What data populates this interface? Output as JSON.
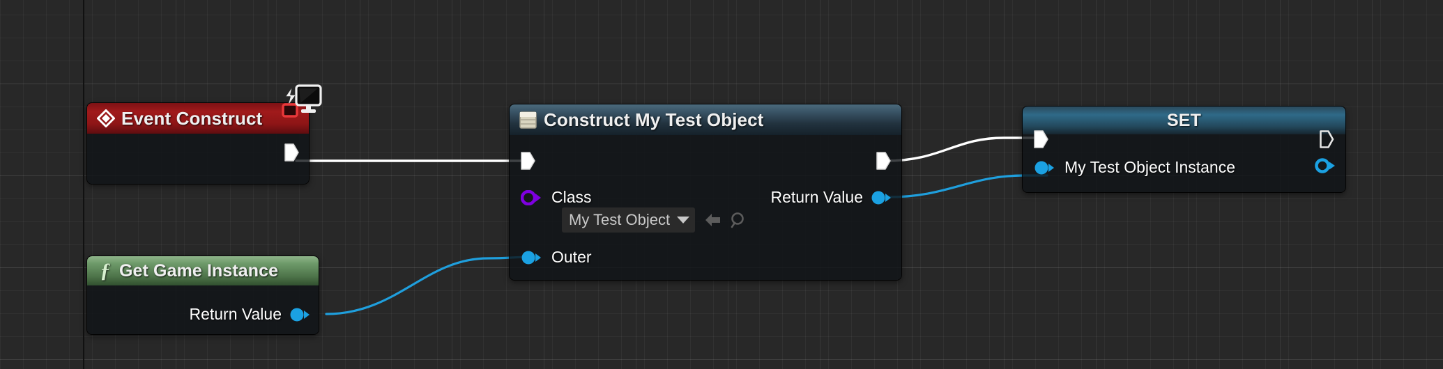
{
  "app": {
    "context": "unreal-blueprint-graph",
    "background_color": "#282828",
    "grid_line_color": "#3a3a3a",
    "axis_line_color": "#111111"
  },
  "colors": {
    "exec_wire": "#ffffff",
    "data_wire_object": "#1f9fdd",
    "pin_object_blue": "#1ba1e2",
    "pin_class_purple": "#7e00e0",
    "title_event_red": "#a01a1b",
    "title_function_green": "#6e9a6a",
    "title_construct_blue": "#3b5668",
    "title_set_blue": "#2f6a88"
  },
  "nodes": {
    "event_construct": {
      "title": "Event Construct",
      "title_icon": "event-diamond-icon",
      "corner_icon": "target-monitor-icon",
      "exec_out": {
        "name": "exec-output-pin",
        "style": "filled"
      }
    },
    "get_game_instance": {
      "title": "Get Game Instance",
      "title_icon": "function-f-icon",
      "outputs": [
        {
          "label": "Return Value",
          "pin": "object-pin",
          "style": "filled"
        }
      ]
    },
    "construct_my_test_object": {
      "title": "Construct My Test Object",
      "title_icon": "construct-object-icon",
      "exec_in": {
        "name": "exec-input-pin",
        "style": "filled"
      },
      "exec_out": {
        "name": "exec-output-pin",
        "style": "filled"
      },
      "inputs": [
        {
          "label": "Class",
          "pin": "class-pin",
          "style": "ring"
        },
        {
          "label": "Outer",
          "pin": "object-pin",
          "style": "filled"
        }
      ],
      "outputs": [
        {
          "label": "Return Value",
          "pin": "object-pin",
          "style": "filled"
        }
      ],
      "class_selector": {
        "value": "My Test Object",
        "caret": "chevron-down-icon",
        "use_selected_icon": "arrow-left-icon",
        "browse_icon": "magnifier-icon"
      }
    },
    "set_node": {
      "title": "SET",
      "exec_in": {
        "name": "exec-input-pin",
        "style": "filled"
      },
      "exec_out": {
        "name": "exec-output-pin",
        "style": "hollow"
      },
      "inputs": [
        {
          "label": "My Test Object Instance",
          "pin": "object-pin",
          "style": "filled"
        }
      ],
      "outputs": [
        {
          "label": "",
          "pin": "object-pin",
          "style": "ring"
        }
      ]
    }
  },
  "wires": [
    {
      "name": "exec-event-to-construct",
      "type": "exec",
      "from": "event_construct.exec_out",
      "to": "construct_my_test_object.exec_in"
    },
    {
      "name": "exec-construct-to-set",
      "type": "exec",
      "from": "construct_my_test_object.exec_out",
      "to": "set_node.exec_in"
    },
    {
      "name": "data-gameinstance-to-outer",
      "type": "data",
      "from": "get_game_instance.return_value",
      "to": "construct_my_test_object.outer"
    },
    {
      "name": "data-returnvalue-to-set",
      "type": "data",
      "from": "construct_my_test_object.return_value",
      "to": "set_node.my_test_object_instance"
    }
  ]
}
